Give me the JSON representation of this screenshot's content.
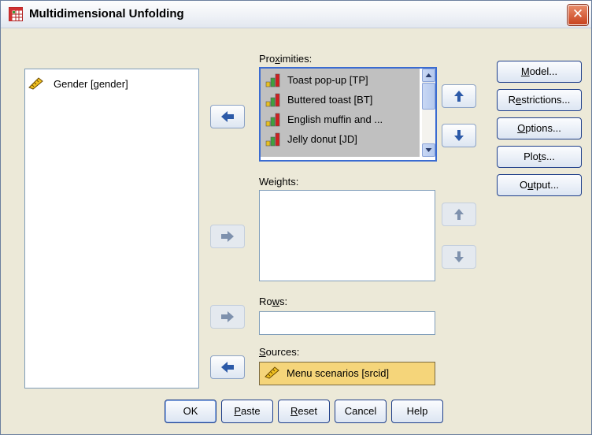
{
  "window": {
    "title": "Multidimensional Unfolding",
    "close_label": "✕"
  },
  "variables": {
    "items": [
      {
        "label": "Gender [gender]",
        "icon": "scale-ruler-icon"
      }
    ]
  },
  "proximities": {
    "label_pre": "Pro",
    "label_hot": "x",
    "label_post": "imities:",
    "items": [
      {
        "label": "Toast pop-up [TP]",
        "icon": "bar-scale-icon"
      },
      {
        "label": "Buttered toast [BT]",
        "icon": "bar-scale-icon"
      },
      {
        "label": "English muffin and ...",
        "icon": "bar-scale-icon"
      },
      {
        "label": "Jelly donut [JD]",
        "icon": "bar-scale-icon"
      }
    ]
  },
  "weights": {
    "label_pre": "Wei",
    "label_hot": "g",
    "label_post": "hts:"
  },
  "rows": {
    "label_pre": "Ro",
    "label_hot": "w",
    "label_post": "s:",
    "value": ""
  },
  "sources": {
    "label_pre": "",
    "label_hot": "S",
    "label_post": "ources:",
    "value": "Menu scenarios [srcid]"
  },
  "side_buttons": {
    "model": {
      "pre": "",
      "hot": "M",
      "post": "odel..."
    },
    "restrictions": {
      "pre": "R",
      "hot": "e",
      "post": "strictions..."
    },
    "options": {
      "pre": "",
      "hot": "O",
      "post": "ptions..."
    },
    "plots": {
      "pre": "Plo",
      "hot": "t",
      "post": "s..."
    },
    "output": {
      "pre": "O",
      "hot": "u",
      "post": "tput..."
    }
  },
  "bottom_buttons": {
    "ok": "OK",
    "paste": {
      "pre": "",
      "hot": "P",
      "post": "aste"
    },
    "reset": {
      "pre": "",
      "hot": "R",
      "post": "eset"
    },
    "cancel": "Cancel",
    "help": "Help"
  },
  "colors": {
    "selected_bg": "#c0c0c0",
    "sources_bg": "#f5d57a",
    "accent": "#2c5aa8"
  }
}
